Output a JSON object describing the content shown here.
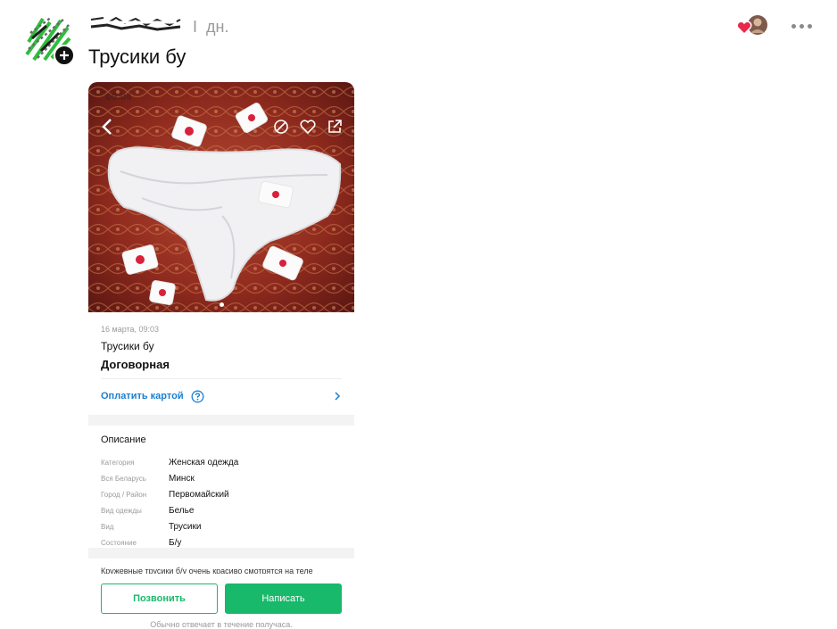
{
  "post": {
    "username": "",
    "separator": "I",
    "timestamp": "дн.",
    "text": "Трусики бу"
  },
  "reactions": {
    "icons": [
      "heart-icon",
      "reactor-avatar"
    ]
  },
  "screenshot": {
    "status_time": "09:04",
    "status_battery": "",
    "photo_icons": [
      "back-arrow-icon",
      "block-icon",
      "heart-outline-icon",
      "share-icon"
    ],
    "photo_pages": 1,
    "ad": {
      "date": "16 марта, 09:03",
      "title": "Трусики бу",
      "price": "Договорная",
      "pay_label": "Оплатить картой"
    },
    "description": {
      "heading": "Описание",
      "properties": [
        {
          "key": "Категория",
          "value": "Женская одежда"
        },
        {
          "key": "Вся Беларусь",
          "value": "Минск"
        },
        {
          "key": "Город / Район",
          "value": "Первомайский"
        },
        {
          "key": "Вид одежды",
          "value": "Белье"
        },
        {
          "key": "Вид",
          "value": "Трусики"
        },
        {
          "key": "Состояние",
          "value": "Б/у"
        }
      ],
      "text_preview": "Кружевные трусики б/у очень красиво смотрятся на теле"
    },
    "buttons": {
      "call": "Позвонить",
      "write": "Написать"
    },
    "reply_note": "Обычно отвечает в течение получаса."
  },
  "colors": {
    "accent_green": "#18b96a",
    "link_blue": "#1a7fd0",
    "muted": "#9b9b9b",
    "reaction_red": "#e8294a"
  }
}
